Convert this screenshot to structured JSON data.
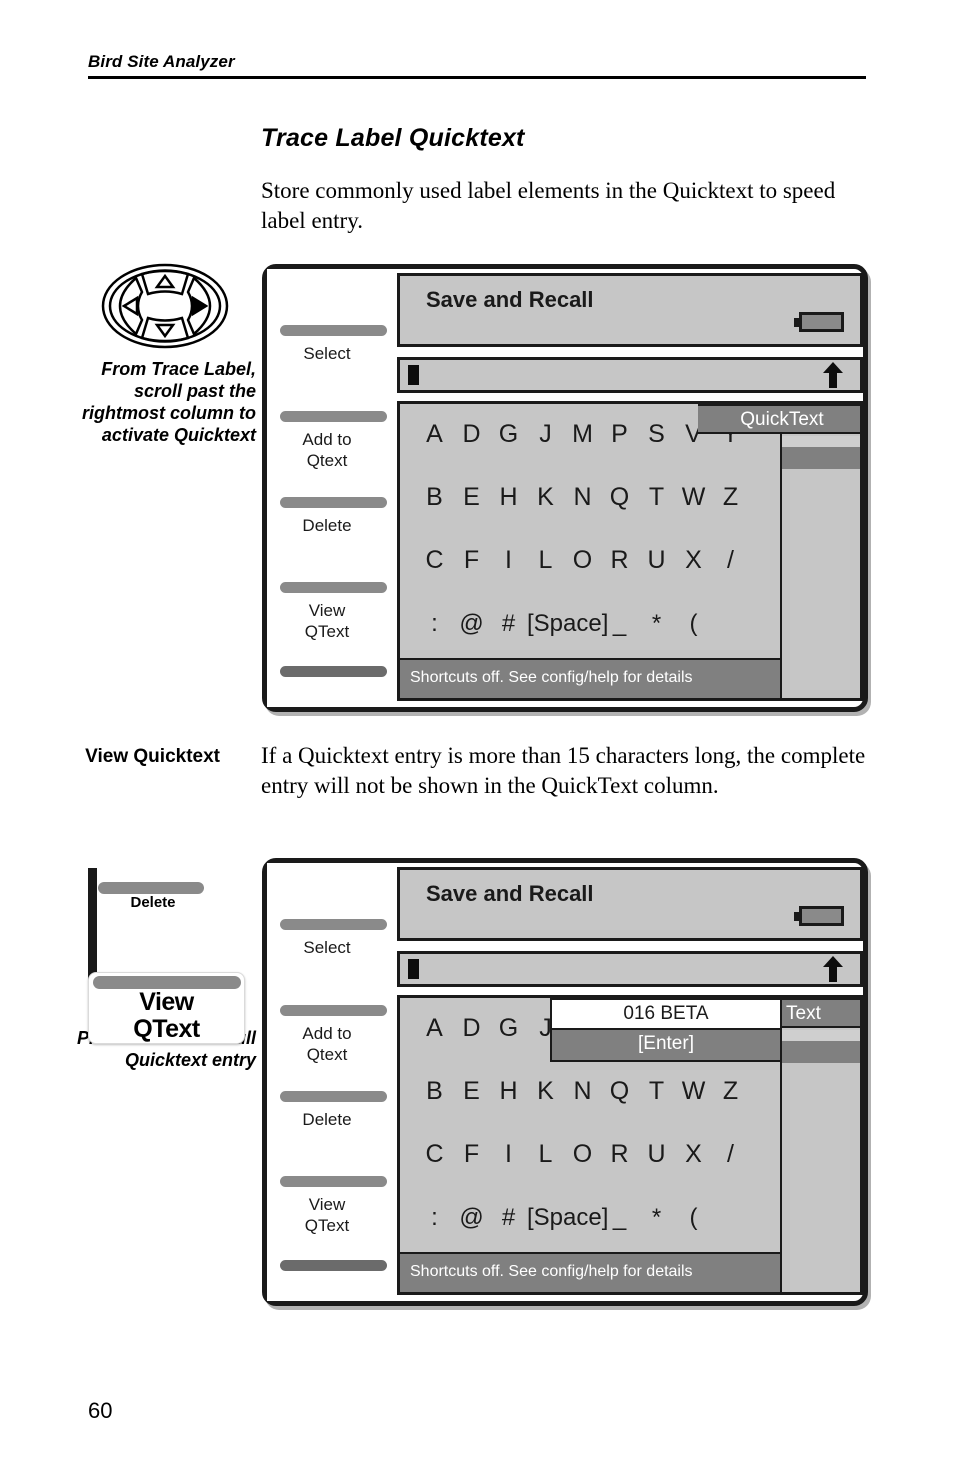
{
  "header": {
    "running_head": "Bird Site Analyzer"
  },
  "section": {
    "title": "Trace Label Quicktext",
    "intro_paragraph": "Store commonly used label elements in the Quicktext to speed label entry."
  },
  "callout_1": {
    "icon": "dpad-navigation-icon",
    "caption": "From Trace Label, scroll past the rightmost column to activate Quicktext"
  },
  "view_quicktext": {
    "side_label": "View Quicktext",
    "paragraph": "If a Quicktext entry is more than 15 characters long, the complete entry will not be shown in the QuickText column."
  },
  "callout_2": {
    "small_key_label": "Delete",
    "button_label_line1": "View",
    "button_label_line2": "QText",
    "caption": "Press to view the full Quicktext entry"
  },
  "device": {
    "softkeys": [
      {
        "label": "Select"
      },
      {
        "label": "Add to\nQtext"
      },
      {
        "label": "Delete"
      },
      {
        "label": "View\nQText"
      },
      {
        "label": ""
      }
    ],
    "title": "Save and Recall",
    "battery_icon": "battery-icon",
    "entry_cursor": "text-cursor",
    "shift_icon": "up-arrow-icon",
    "keyboard_rows": [
      [
        "A",
        "D",
        "G",
        "J",
        "M",
        "P",
        "S",
        "V",
        "Y"
      ],
      [
        "B",
        "E",
        "H",
        "K",
        "N",
        "Q",
        "T",
        "W",
        "Z"
      ],
      [
        "C",
        "F",
        "I",
        "L",
        "O",
        "R",
        "U",
        "X",
        "/"
      ],
      [
        ":",
        "@",
        "#",
        "[Space]",
        "_",
        "*",
        "("
      ]
    ],
    "status_text": "Shortcuts off. See config/help for details",
    "quicktext_column_header": "QuickText"
  },
  "device2": {
    "popup_value": "016 BETA",
    "popup_enter": "[Enter]",
    "quicktext_column_header_clipped": "Text"
  },
  "footer": {
    "page_number": "60"
  },
  "colors": {
    "screen_bg": "#c6c6c6",
    "panel_dark": "#808080",
    "frame": "#1a1a1a",
    "softkey_bar": "#8a8a8a"
  }
}
